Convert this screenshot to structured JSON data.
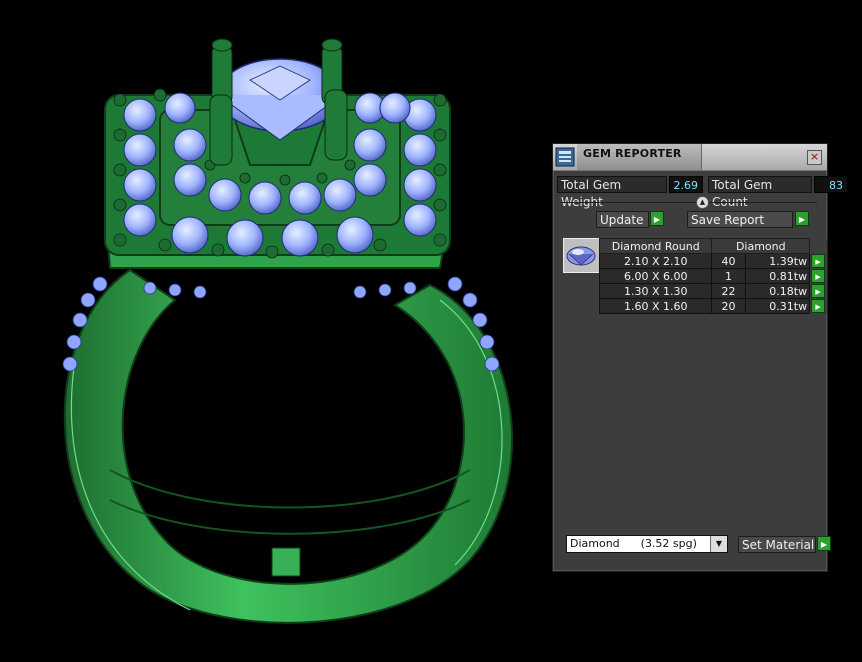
{
  "panel": {
    "title": "GEM REPORTER",
    "close_glyph": "×",
    "total_weight_label": "Total Gem Weight",
    "total_weight_value": "2.69",
    "total_count_label": "Total Gem Count",
    "total_count_value": "83",
    "update_label": "Update",
    "save_label": "Save Report",
    "table": {
      "headers": [
        "Diamond Round",
        "Diamond"
      ],
      "rows": [
        {
          "size": "2.10 X 2.10",
          "count": "40",
          "weight": "1.39tw"
        },
        {
          "size": "6.00 X 6.00",
          "count": "1",
          "weight": "0.81tw"
        },
        {
          "size": "1.30 X 1.30",
          "count": "22",
          "weight": "0.18tw"
        },
        {
          "size": "1.60 X 1.60",
          "count": "20",
          "weight": "0.31tw"
        }
      ]
    },
    "material_select": "Diamond      (3.52 spg)",
    "set_material_label": "Set Material"
  },
  "icons": {
    "play": "▶",
    "collapse": "▲",
    "dropdown": "▼"
  },
  "colors": {
    "metal": "#2e9e4a",
    "gem": "#8aa6ff",
    "value_text": "#7fe0ff",
    "action_green": "#2da12d"
  }
}
